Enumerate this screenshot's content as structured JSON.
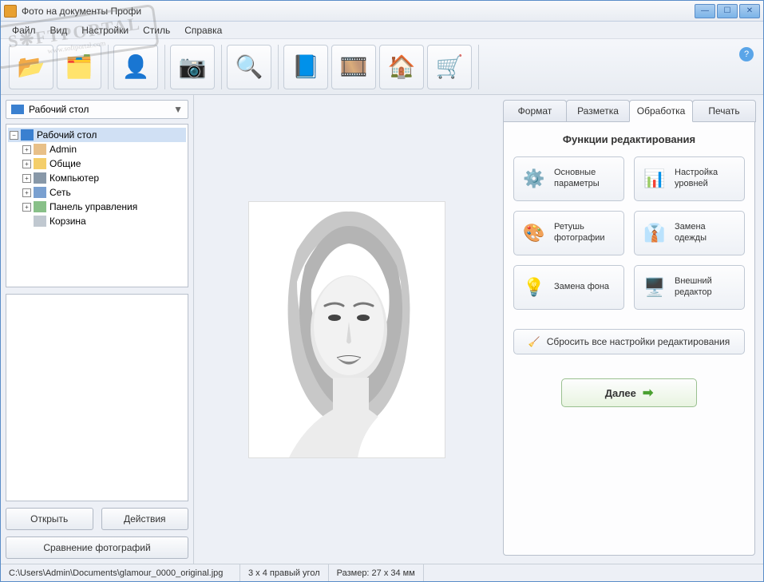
{
  "window": {
    "title": "Фото на документы Профи"
  },
  "menu": {
    "file": "Файл",
    "view": "Вид",
    "settings": "Настройки",
    "style": "Стиль",
    "help": "Справка"
  },
  "toolbarIcons": {
    "open1": "folder-open-icon",
    "open2": "folders-icon",
    "person": "person-search-icon",
    "camera": "camera-icon",
    "search": "magnifier-image-icon",
    "book": "help-book-icon",
    "reel": "film-reel-icon",
    "home": "home-icon",
    "cart": "shopping-cart-icon"
  },
  "sidebar": {
    "combo_label": "Рабочий стол",
    "tree": {
      "root": "Рабочий стол",
      "items": [
        "Admin",
        "Общие",
        "Компьютер",
        "Сеть",
        "Панель управления",
        "Корзина"
      ]
    },
    "open_btn": "Открыть",
    "actions_btn": "Действия",
    "compare_btn": "Сравнение фотографий"
  },
  "rightPanel": {
    "tabs": {
      "format": "Формат",
      "layout": "Разметка",
      "processing": "Обработка",
      "print": "Печать"
    },
    "active_tab": "processing",
    "pane_title": "Функции редактирования",
    "functions": {
      "basic": "Основные параметры",
      "levels": "Настройка уровней",
      "retouch": "Ретушь фотографии",
      "clothes": "Замена одежды",
      "background": "Замена фона",
      "external": "Внешний редактор"
    },
    "reset_btn": "Сбросить все настройки редактирования",
    "next_btn": "Далее"
  },
  "statusbar": {
    "path": "C:\\Users\\Admin\\Documents\\glamour_0000_original.jpg",
    "format": "3 x 4 правый угол",
    "size": "Размер: 27 x 34 мм"
  },
  "watermark": {
    "main": "S❋FTPORTAL",
    "sub": "www.softportal.com"
  }
}
